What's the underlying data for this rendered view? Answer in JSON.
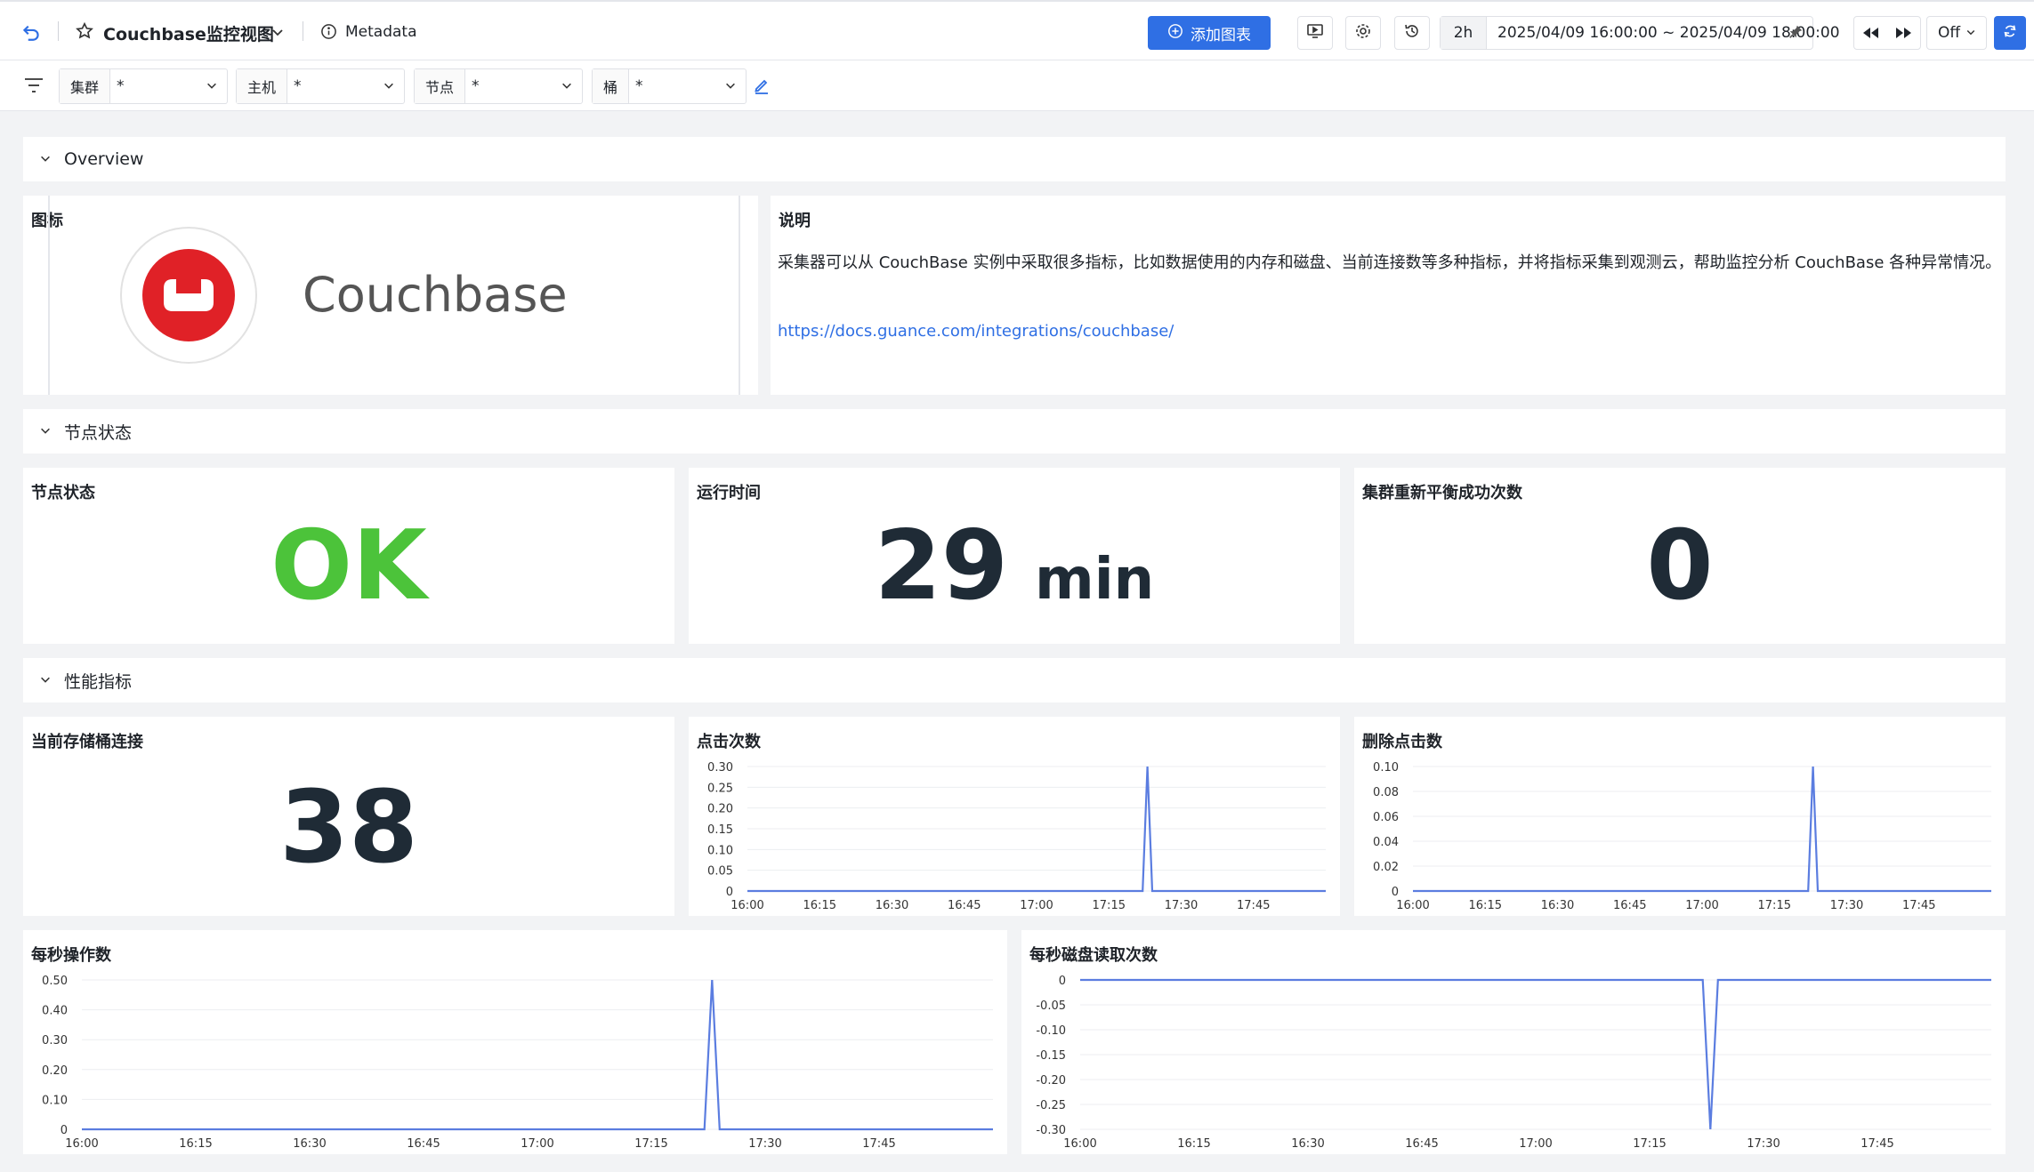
{
  "header": {
    "title": "Couchbase监控视图",
    "metadata_label": "Metadata",
    "add_chart_label": "添加图表",
    "time_range_short": "2h",
    "time_range": "2025/04/09 16:00:00 ~ 2025/04/09 18:00:00",
    "refresh_mode": "Off"
  },
  "filters": [
    {
      "label": "集群",
      "value": "*"
    },
    {
      "label": "主机",
      "value": "*"
    },
    {
      "label": "节点",
      "value": "*"
    },
    {
      "label": "桶",
      "value": "*"
    }
  ],
  "sections": {
    "overview": "Overview",
    "node_status": "节点状态",
    "performance": "性能指标"
  },
  "overview": {
    "icon_panel_title": "图标",
    "logo_text": "Couchbase",
    "desc_panel_title": "说明",
    "description": "采集器可以从 CouchBase 实例中采取很多指标，比如数据使用的内存和磁盘、当前连接数等多种指标，并将指标采集到观测云，帮助监控分析 CouchBase 各种异常情况。",
    "doc_link": "https://docs.guance.com/integrations/couchbase/"
  },
  "node_status": {
    "status_title": "节点状态",
    "status_value": "OK",
    "uptime_title": "运行时间",
    "uptime_value": "29",
    "uptime_unit": "min",
    "rebalance_title": "集群重新平衡成功次数",
    "rebalance_value": "0"
  },
  "performance": {
    "conn_title": "当前存储桶连接",
    "conn_value": "38"
  },
  "colors": {
    "accent": "#2f6fe4",
    "ok": "#4cc33a",
    "line": "#5b7de0",
    "bignum": "#1f2b36"
  },
  "chart_data": [
    {
      "type": "line",
      "title": "点击次数",
      "x": [
        "16:00",
        "16:15",
        "16:30",
        "16:45",
        "17:00",
        "17:15",
        "17:30",
        "17:45"
      ],
      "ylim": [
        0,
        0.3
      ],
      "yticks": [
        "0.30",
        "0.25",
        "0.20",
        "0.15",
        "0.10",
        "0.05",
        "0"
      ],
      "series": [
        {
          "points": [
            [
              "16:00",
              0
            ],
            [
              "17:22",
              0
            ],
            [
              "17:23",
              0.3
            ],
            [
              "17:24",
              0
            ],
            [
              "18:00",
              0
            ]
          ]
        }
      ]
    },
    {
      "type": "line",
      "title": "删除点击数",
      "x": [
        "16:00",
        "16:15",
        "16:30",
        "16:45",
        "17:00",
        "17:15",
        "17:30",
        "17:45"
      ],
      "ylim": [
        0,
        0.1
      ],
      "yticks": [
        "0.10",
        "0.08",
        "0.06",
        "0.04",
        "0.02",
        "0"
      ],
      "series": [
        {
          "points": [
            [
              "16:00",
              0
            ],
            [
              "17:22",
              0
            ],
            [
              "17:23",
              0.1
            ],
            [
              "17:24",
              0
            ],
            [
              "18:00",
              0
            ]
          ]
        }
      ]
    },
    {
      "type": "line",
      "title": "每秒操作数",
      "x": [
        "16:00",
        "16:15",
        "16:30",
        "16:45",
        "17:00",
        "17:15",
        "17:30",
        "17:45"
      ],
      "ylim": [
        0,
        0.5
      ],
      "yticks": [
        "0.50",
        "0.40",
        "0.30",
        "0.20",
        "0.10",
        "0"
      ],
      "series": [
        {
          "points": [
            [
              "16:00",
              0
            ],
            [
              "17:22",
              0
            ],
            [
              "17:23",
              0.5
            ],
            [
              "17:24",
              0
            ],
            [
              "18:00",
              0
            ]
          ]
        }
      ]
    },
    {
      "type": "line",
      "title": "每秒磁盘读取次数",
      "x": [
        "16:00",
        "16:15",
        "16:30",
        "16:45",
        "17:00",
        "17:15",
        "17:30",
        "17:45"
      ],
      "ylim": [
        -0.3,
        0
      ],
      "yticks": [
        "0",
        "-0.05",
        "-0.10",
        "-0.15",
        "-0.20",
        "-0.25",
        "-0.30"
      ],
      "series": [
        {
          "points": [
            [
              "16:00",
              0
            ],
            [
              "17:22",
              0
            ],
            [
              "17:23",
              -0.3
            ],
            [
              "17:24",
              0
            ],
            [
              "18:00",
              0
            ]
          ]
        }
      ]
    }
  ]
}
